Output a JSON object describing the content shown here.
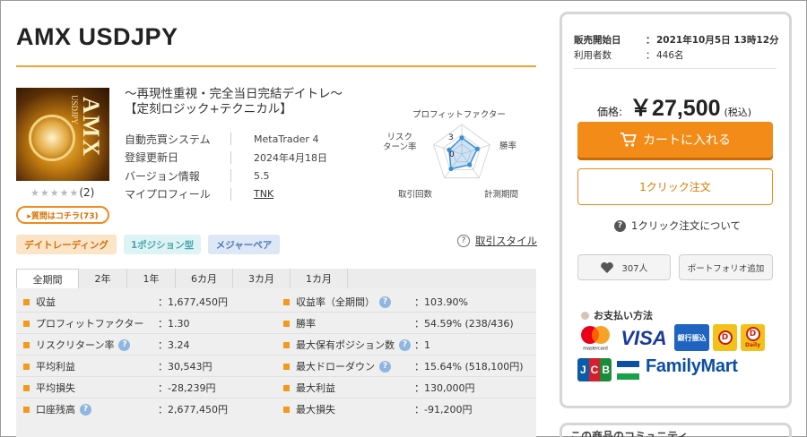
{
  "product": {
    "title": "AMX USDJPY",
    "tagline1": "～再現性重視・完全当日完結デイトレ～",
    "tagline2": "【定刻ロジック+テクニカル】",
    "thumbnail_text": "AMX",
    "thumbnail_sub": "USDJPY",
    "stars": "★★★★★",
    "review_count": "(2)",
    "qa_button": "▸質問はコチラ(73)"
  },
  "spec": [
    {
      "label": "自動売買システム",
      "value": "MetaTrader 4"
    },
    {
      "label": "登録更新日",
      "value": "2024年4月18日"
    },
    {
      "label": "バージョン情報",
      "value": "5.5"
    },
    {
      "label": "マイプロフィール",
      "value": "TNK"
    }
  ],
  "radar": {
    "labels": {
      "profit_factor": "プロフィットファクター",
      "win_rate": "勝率",
      "period": "計測期間",
      "trades": "取引回数",
      "risk_return": "リスク\nターン率"
    },
    "scale_max": "3",
    "scale_min": "0",
    "values": {
      "profit_factor": 0.55,
      "win_rate": 0.55,
      "period": 0.45,
      "trades": 0.62,
      "risk_return": 0.45
    },
    "color": "#3b8fd9"
  },
  "tags": [
    "デイトレーディング",
    "1ポジション型",
    "メジャーペア"
  ],
  "trade_style": {
    "label": "取引スタイル",
    "icon": "question-circle-icon"
  },
  "tabs": [
    "全期間",
    "2年",
    "1年",
    "6カ月",
    "3カ月",
    "1カ月"
  ],
  "stats": {
    "left": [
      {
        "label": "収益",
        "value": "：1,677,450円",
        "help": false
      },
      {
        "label": "プロフィットファクター",
        "value": "：1.30",
        "help": false
      },
      {
        "label": "リスクリターン率",
        "value": "：3.24",
        "help": true
      },
      {
        "label": "平均利益",
        "value": "：30,543円",
        "help": false
      },
      {
        "label": "平均損失",
        "value": "：-28,239円",
        "help": false
      },
      {
        "label": "口座残高",
        "value": "：2,677,450円",
        "help": true
      }
    ],
    "right": [
      {
        "label": "収益率（全期間）",
        "value": "：103.90%",
        "help": true
      },
      {
        "label": "勝率",
        "value": "：54.59% (238/436)",
        "help": false
      },
      {
        "label": "最大保有ポジション数",
        "value": "：1",
        "help": true
      },
      {
        "label": "最大ドローダウン",
        "value": "：15.64% (518,100円)",
        "help": true
      },
      {
        "label": "最大利益",
        "value": "：130,000円",
        "help": false
      },
      {
        "label": "最大損失",
        "value": "：-91,200円",
        "help": false
      }
    ],
    "help_glyph": "?"
  },
  "panel": {
    "sale_start_label": "販売開始日",
    "sale_start_value": "2021年10月5日 13時12分",
    "users_label": "利用者数",
    "users_value": "446名",
    "colon": "：",
    "price_label": "価格:",
    "price": "￥27,500",
    "tax": "(税込)",
    "cart_button": "カートに入れる",
    "oneclick_button": "1クリック注文",
    "oneclick_help": "1クリック注文について",
    "favorite_count": "307人",
    "portfolio_button": "ポートフォリオ追加",
    "payment_title": "お支払い方法",
    "visa": "VISA",
    "bank": "銀行振込",
    "dy_label": "Daily",
    "jcb": [
      "J",
      "C",
      "B"
    ],
    "familymart": "FamilyMart",
    "mastercard_label": "mastercard",
    "bottom_heading": "この商品のコミュニティ"
  },
  "colors": {
    "accent": "#f28b17",
    "help_icon": "#8fb6e1",
    "title_rule": "#f3a233"
  }
}
